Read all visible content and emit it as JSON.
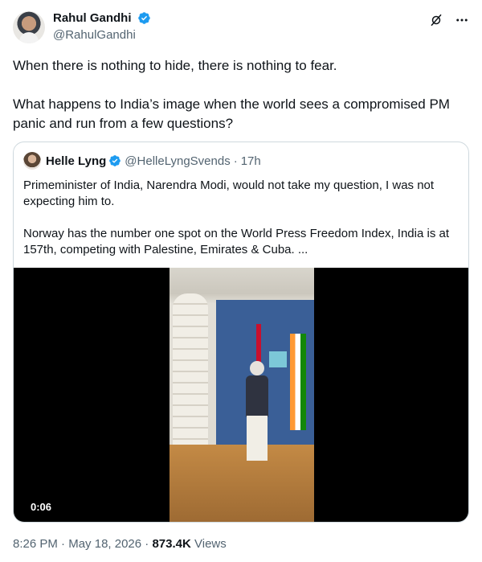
{
  "author": {
    "display_name": "Rahul Gandhi",
    "handle": "@RahulGandhi",
    "verified_icon": "verified-badge-icon"
  },
  "header_actions": {
    "grok_icon": "grok-icon",
    "more_icon": "more-icon",
    "more_label": "···"
  },
  "tweet": {
    "paragraph1": "When there is nothing to hide, there is nothing to fear.",
    "paragraph2": "What happens to India’s image when the world sees a compromised PM panic and run from a few questions?"
  },
  "quote": {
    "display_name": "Helle Lyng",
    "handle": "@HelleLyngSvends",
    "separator": "·",
    "time": "17h",
    "paragraph1": "Primeminister of India, Narendra Modi, would not take my question, I was not expecting him to.",
    "paragraph2": "Norway has the number one spot on the World Press Freedom Index, India is at 157th, competing with Palestine, Emirates & Cuba. ...",
    "video_time": "0:06"
  },
  "footer": {
    "time": "8:26 PM",
    "dot": "·",
    "date": "May 18, 2026",
    "dot2": "·",
    "views_count": "873.4K",
    "views_label": "Views"
  },
  "colors": {
    "verified_blue": "#1d9bf0",
    "text_primary": "#0f1419",
    "text_secondary": "#536471",
    "border": "#cfd9de"
  }
}
